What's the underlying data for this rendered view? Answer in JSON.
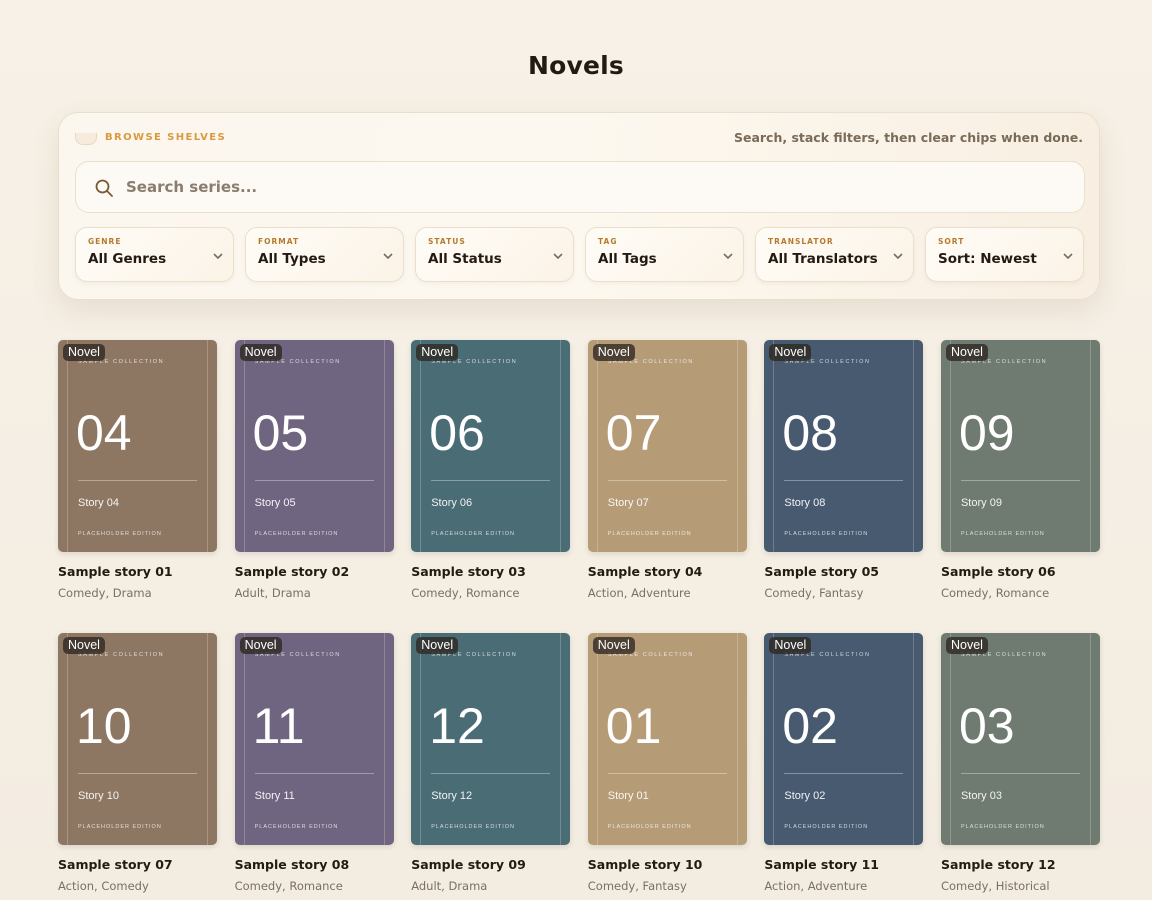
{
  "page": {
    "title": "Novels"
  },
  "filters": {
    "label": "BROWSE SHELVES",
    "hint": "Search, stack filters, then clear chips when done.",
    "search_placeholder": "Search series...",
    "selects": [
      {
        "caption": "GENRE",
        "value": "All Genres"
      },
      {
        "caption": "FORMAT",
        "value": "All Types"
      },
      {
        "caption": "STATUS",
        "value": "All Status"
      },
      {
        "caption": "TAG",
        "value": "All Tags"
      },
      {
        "caption": "TRANSLATOR",
        "value": "All Translators"
      },
      {
        "caption": "SORT",
        "value": "Sort: Newest"
      }
    ]
  },
  "cover_text": {
    "collection": "SAMPLE COLLECTION",
    "edition": "PLACEHOLDER EDITION"
  },
  "colors": {
    "accent": "#d99a3f",
    "cover_brown": "#8d7763",
    "cover_purple": "#706580",
    "cover_teal": "#4a6c74",
    "cover_sand": "#b59c77",
    "cover_navy": "#475a70",
    "cover_sage": "#6f7a70"
  },
  "cards": [
    {
      "badge": "Novel",
      "number": "04",
      "story": "Story 04",
      "title": "Sample story 01",
      "genres": "Comedy, Drama",
      "color": "#8d7763"
    },
    {
      "badge": "Novel",
      "number": "05",
      "story": "Story 05",
      "title": "Sample story 02",
      "genres": "Adult, Drama",
      "color": "#706580"
    },
    {
      "badge": "Novel",
      "number": "06",
      "story": "Story 06",
      "title": "Sample story 03",
      "genres": "Comedy, Romance",
      "color": "#4a6c74"
    },
    {
      "badge": "Novel",
      "number": "07",
      "story": "Story 07",
      "title": "Sample story 04",
      "genres": "Action, Adventure",
      "color": "#b59c77"
    },
    {
      "badge": "Novel",
      "number": "08",
      "story": "Story 08",
      "title": "Sample story 05",
      "genres": "Comedy, Fantasy",
      "color": "#475a70"
    },
    {
      "badge": "Novel",
      "number": "09",
      "story": "Story 09",
      "title": "Sample story 06",
      "genres": "Comedy, Romance",
      "color": "#6f7a70"
    },
    {
      "badge": "Novel",
      "number": "10",
      "story": "Story 10",
      "title": "Sample story 07",
      "genres": "Action, Comedy",
      "color": "#8d7763"
    },
    {
      "badge": "Novel",
      "number": "11",
      "story": "Story 11",
      "title": "Sample story 08",
      "genres": "Comedy, Romance",
      "color": "#706580"
    },
    {
      "badge": "Novel",
      "number": "12",
      "story": "Story 12",
      "title": "Sample story 09",
      "genres": "Adult, Drama",
      "color": "#4a6c74"
    },
    {
      "badge": "Novel",
      "number": "01",
      "story": "Story 01",
      "title": "Sample story 10",
      "genres": "Comedy, Fantasy",
      "color": "#b59c77"
    },
    {
      "badge": "Novel",
      "number": "02",
      "story": "Story 02",
      "title": "Sample story 11",
      "genres": "Action, Adventure",
      "color": "#475a70"
    },
    {
      "badge": "Novel",
      "number": "03",
      "story": "Story 03",
      "title": "Sample story 12",
      "genres": "Comedy, Historical",
      "color": "#6f7a70"
    }
  ]
}
